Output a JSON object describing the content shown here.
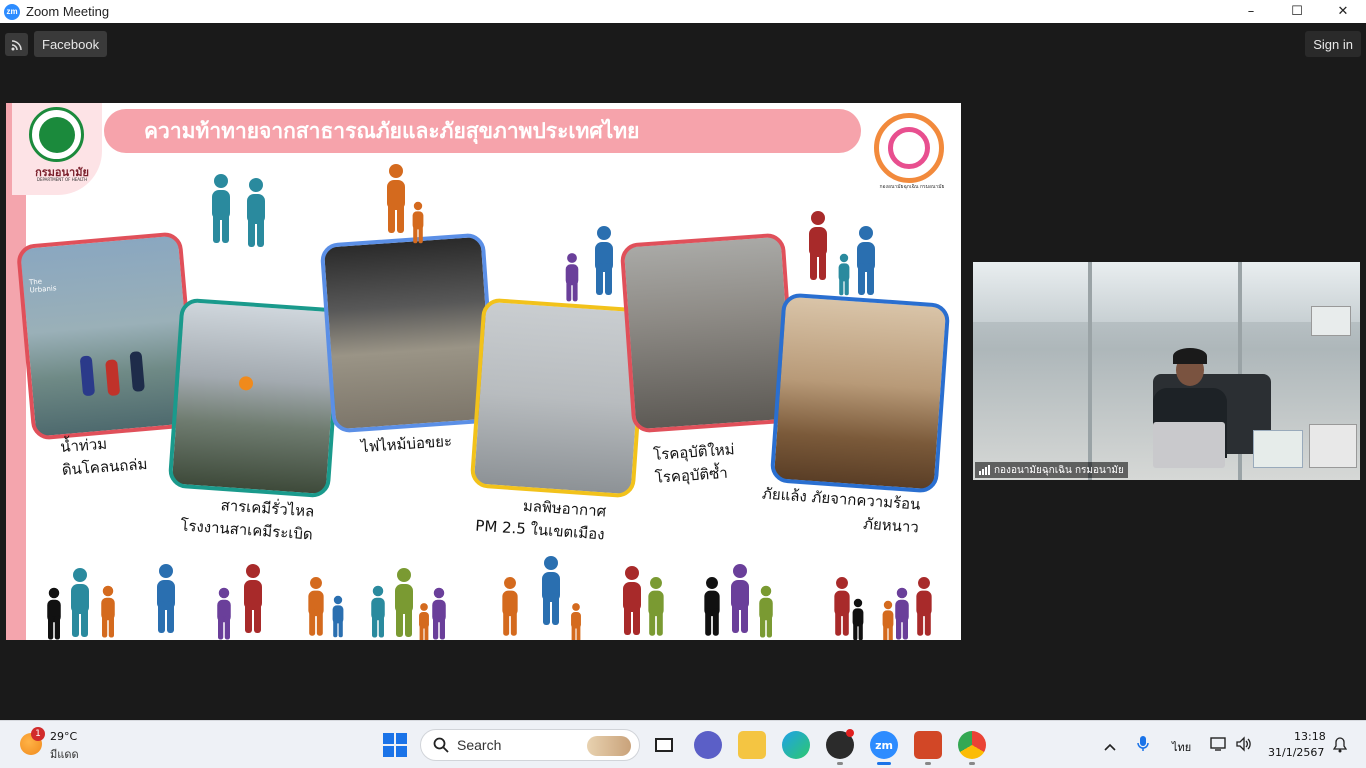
{
  "window": {
    "title": "Zoom Meeting",
    "app_logo_text": "zm",
    "controls": [
      "–",
      "☐",
      "✕"
    ]
  },
  "zoom_toolbar": {
    "tab_label": "Facebook",
    "signin_label": "Sign in"
  },
  "slide": {
    "title": "ความท้าทายจากสาธารณภัยและภัยสุขภาพประเทศไทย",
    "logo_left_text": "กรมอนามัย",
    "logo_left_sub": "DEPARTMENT OF HEALTH",
    "logo_right_text": "กองอนามัยฉุกเฉิน กรมอนามัย",
    "labels": [
      {
        "line1": "น้ำท่วม",
        "line2": "ดินโคลนถล่ม"
      },
      {
        "line1": "สารเคมีรั่วไหล",
        "line2": "โรงงานสาเคมีระเบิด"
      },
      {
        "line1": "ไฟไหม้บ่อขยะ",
        "line2": ""
      },
      {
        "line1": "มลพิษอากาศ",
        "line2": "PM 2.5 ในเขตเมือง"
      },
      {
        "line1": "โรคอุบัติใหม่",
        "line2": "โรคอุบัติซ้ำ"
      },
      {
        "line1": "ภัยแล้ง ภัยจากความร้อน",
        "line2": "ภัยหนาว"
      }
    ],
    "photo_watermark": "The Urbanis"
  },
  "participant": {
    "name": "กองอนามัยฉุกเฉิน กรมอนามัย"
  },
  "taskbar": {
    "weather_temp": "29°C",
    "weather_desc": "มีแดด",
    "weather_badge": "1",
    "search_placeholder": "Search",
    "language": "ไทย",
    "time": "13:18",
    "date": "31/1/2567",
    "zoom_label": "zm"
  },
  "colors": {
    "banner": "#f6a3ab",
    "zoom_blue": "#2d8cff",
    "border_red": "#e0505a",
    "border_teal": "#1a9a8c",
    "border_blue": "#5b8fe6",
    "border_yellow": "#f2c21b",
    "border_blue2": "#2a6fd0"
  }
}
